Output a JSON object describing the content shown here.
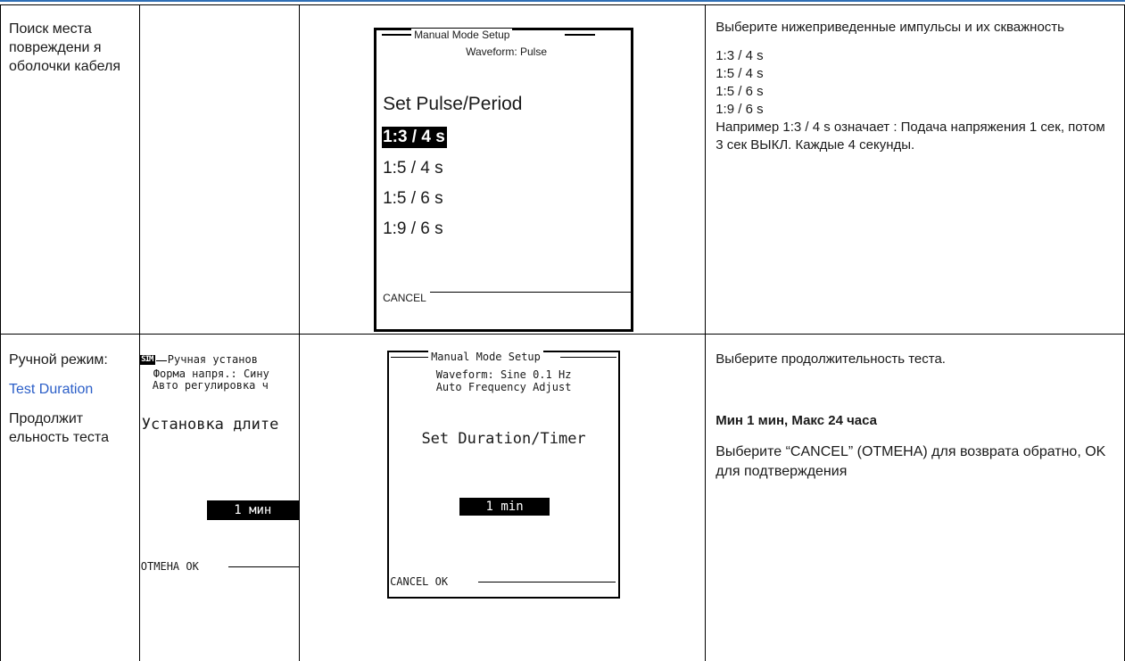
{
  "row1": {
    "section": "Поиск места повреждени я оболочки кабеля",
    "screen": {
      "title": "Manual Mode Setup",
      "waveform": "Waveform: Pulse",
      "heading": "Set Pulse/Period",
      "options": [
        "1:3 / 4 s",
        "1:5 / 4 s",
        "1:5 / 6 s",
        "1:9 / 6 s"
      ],
      "selected_index": 0,
      "cancel": "CANCEL"
    },
    "description": {
      "intro": "Выберите нижеприведенные импульсы и их скважность",
      "options": [
        "1:3 / 4 s",
        "1:5 / 4 s",
        "1:5 / 6 s",
        "1:9 / 6 s"
      ],
      "example": "Например 1:3 / 4 s означает : Подача напряжения 1 сек, потом 3 сек ВЫКЛ. Каждые 4 секунды."
    }
  },
  "row2": {
    "section_title": "Ручной режим:",
    "section_link": "Test Duration",
    "section_ru": "Продолжит ельность теста",
    "screen_ru": {
      "icon": "SIM",
      "title": "Ручная установ",
      "waveform": "Форма напря.: Сину",
      "auto": "Авто регулировка ч",
      "heading": "Установка длите",
      "value": "1 мин",
      "bottom": "ОТМЕНА  OK"
    },
    "screen_en": {
      "title": "Manual Mode Setup",
      "waveform": "Waveform: Sine 0.1 Hz",
      "auto": "Auto Frequency Adjust",
      "heading": "Set Duration/Timer",
      "value": "1 min",
      "bottom": "CANCEL  OK"
    },
    "description": {
      "intro": "Выберите продолжительность теста.",
      "range": "Мин 1 мин, Макс 24 часа",
      "hint": "Выберите “CANCEL” (ОТМЕНА) для возврата обратно, OK для подтверждения"
    }
  }
}
